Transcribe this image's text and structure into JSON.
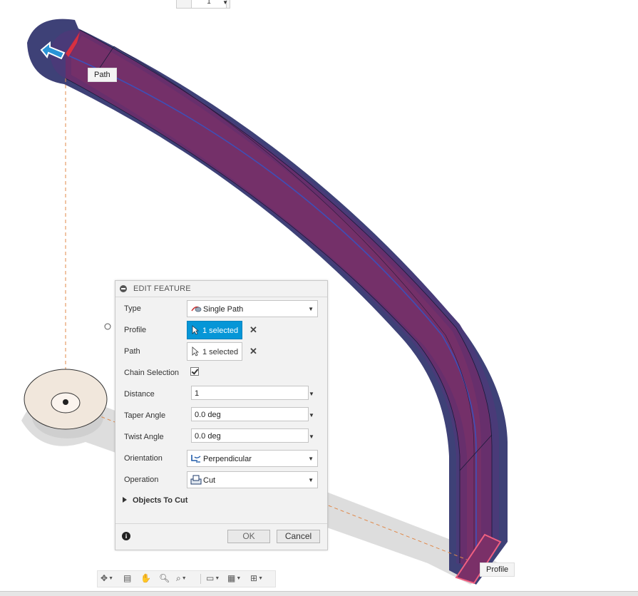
{
  "viewport": {
    "top_field_value": "1",
    "path_label": "Path",
    "profile_label": "Profile"
  },
  "panel": {
    "title": "EDIT FEATURE",
    "rows": {
      "type": {
        "label": "Type",
        "value": "Single Path",
        "icon": "single-path-icon"
      },
      "profile": {
        "label": "Profile",
        "value": "1 selected",
        "state": "active"
      },
      "path": {
        "label": "Path",
        "value": "1 selected"
      },
      "chain_selection": {
        "label": "Chain Selection",
        "checked": true
      },
      "distance": {
        "label": "Distance",
        "value": "1"
      },
      "taper_angle": {
        "label": "Taper Angle",
        "value": "0.0 deg"
      },
      "twist_angle": {
        "label": "Twist Angle",
        "value": "0.0 deg"
      },
      "orientation": {
        "label": "Orientation",
        "value": "Perpendicular",
        "icon": "perpendicular-icon"
      },
      "operation": {
        "label": "Operation",
        "value": "Cut",
        "icon": "cut-icon"
      }
    },
    "objects_section": "Objects To Cut",
    "ok_label": "OK",
    "cancel_label": "Cancel"
  },
  "toolbar": {
    "items": [
      "orbit-icon",
      "look-at-icon",
      "pan-icon",
      "zoom-icon",
      "fit-icon",
      "display-settings-icon",
      "grid-icon",
      "viewports-icon"
    ]
  },
  "colors": {
    "body_dark": "#3e4177",
    "body_mid": "#5a2e64",
    "selection_blue": "#0696d7",
    "cut_red": "#e0405a",
    "dash_orange": "#e0894a"
  }
}
